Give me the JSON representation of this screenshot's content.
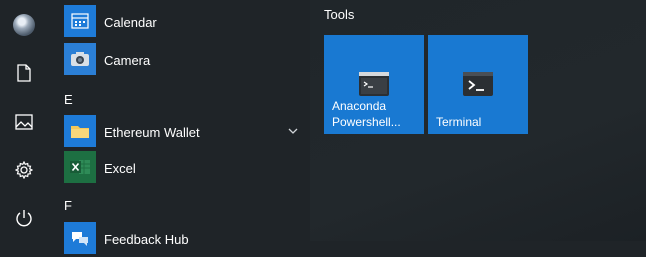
{
  "applist": {
    "items": [
      {
        "label": "Calendar",
        "icon": "calendar-icon"
      },
      {
        "label": "Camera",
        "icon": "camera-icon"
      },
      {
        "letter": "E"
      },
      {
        "label": "Ethereum Wallet",
        "icon": "folder-icon",
        "expandable": true
      },
      {
        "label": "Excel",
        "icon": "excel-icon"
      },
      {
        "letter": "F"
      },
      {
        "label": "Feedback Hub",
        "icon": "feedback-hub-icon"
      }
    ]
  },
  "rail": {
    "icons": [
      "user-avatar",
      "documents-icon",
      "pictures-icon",
      "settings-icon",
      "power-icon"
    ]
  },
  "tiles": {
    "group_title": "Tools",
    "items": [
      {
        "label": "Anaconda\nPowershell...",
        "icon": "anaconda-powershell-icon"
      },
      {
        "label": "Terminal",
        "icon": "terminal-icon"
      }
    ]
  },
  "colors": {
    "background": "#1f2428",
    "tile": "#1979d2",
    "excel": "#1d6f42",
    "calendar": "#1e7bd8",
    "camera": "#2b7fd6",
    "folder": "#f5c85a"
  }
}
